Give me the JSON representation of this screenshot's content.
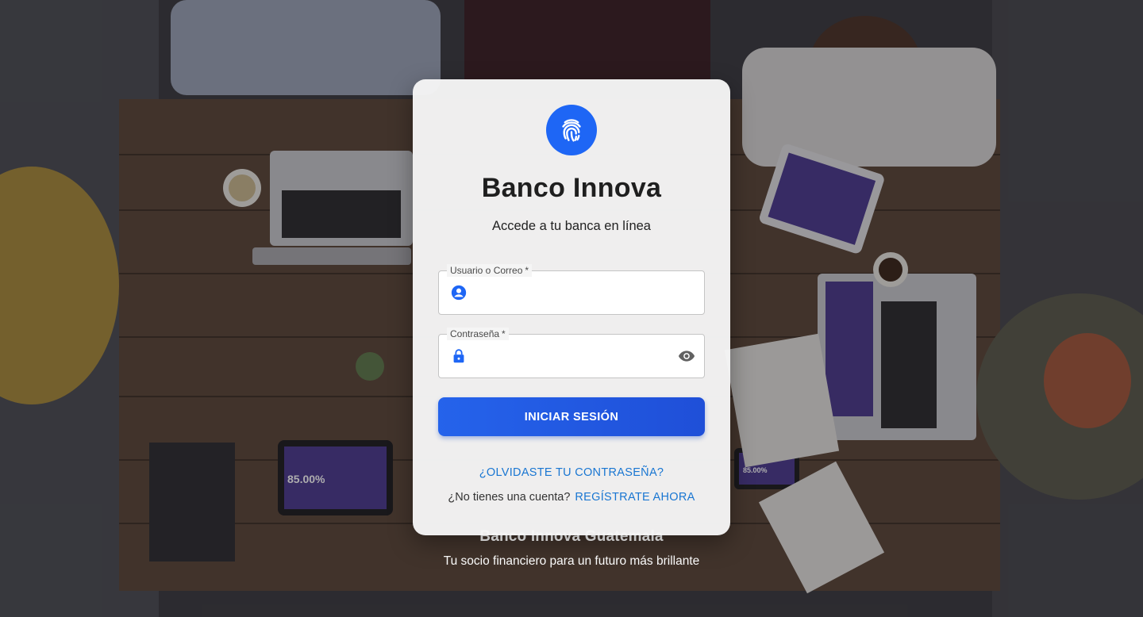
{
  "brand": {
    "name": "Banco Innova",
    "subtitle": "Accede a tu banca en línea",
    "logo_icon": "fingerprint-icon",
    "accent_color": "#1e66f5"
  },
  "form": {
    "username": {
      "label": "Usuario o Correo",
      "required_mark": "*",
      "value": "",
      "icon": "account-circle-icon"
    },
    "password": {
      "label": "Contraseña",
      "required_mark": "*",
      "value": "",
      "icon": "lock-icon",
      "toggle_icon": "eye-icon"
    },
    "submit_label": "INICIAR SESIÓN"
  },
  "links": {
    "forgot_password": "¿OLVIDASTE TU CONTRASEÑA?",
    "no_account_text": "¿No tienes una cuenta?",
    "register": "REGÍSTRATE AHORA",
    "link_color": "#1976d2"
  },
  "footer": {
    "brand": "Banco Innova Guatemala",
    "tagline": "Tu socio financiero para un futuro más brillante"
  },
  "background": {
    "tablet_left_stat": "85.00%",
    "tablet_right_stat": "85.00%",
    "phone_stat": "85.00%"
  }
}
